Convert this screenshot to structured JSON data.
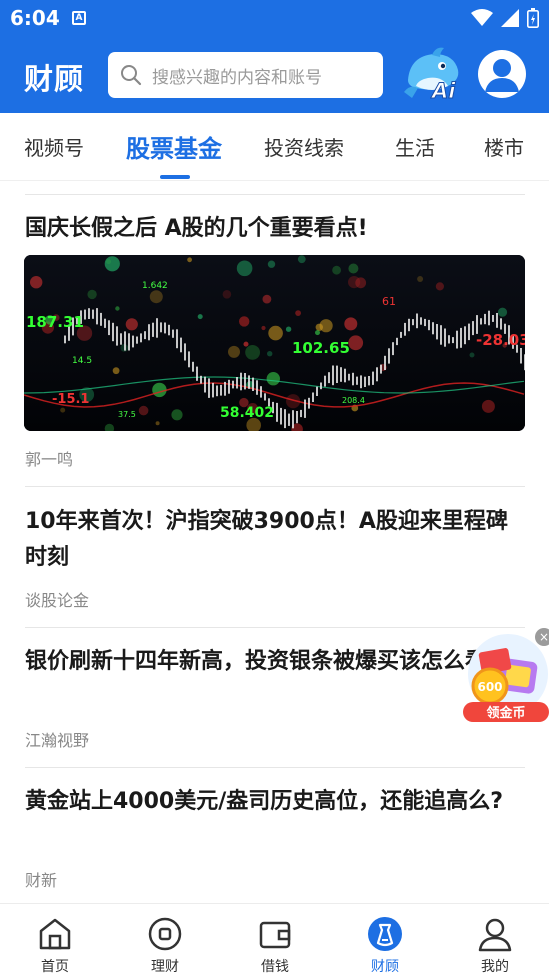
{
  "status_bar": {
    "time": "6:04"
  },
  "header": {
    "brand": "财顾",
    "search_placeholder": "搜感兴趣的内容和账号",
    "ai_badge": "Ai"
  },
  "tabs": [
    {
      "label": "视频号",
      "active": false
    },
    {
      "label": "股票基金",
      "active": true
    },
    {
      "label": "投资线索",
      "active": false
    },
    {
      "label": "生活",
      "active": false
    },
    {
      "label": "楼市",
      "active": false
    }
  ],
  "articles": [
    {
      "title": "国庆长假之后 A股的几个重要看点!",
      "source": "郭一鸣",
      "image_numbers": [
        "1.642",
        "187.31",
        "102.65",
        "-28.03",
        "58.402",
        "-15.1",
        "208.4",
        "37.5",
        "14.5",
        "61"
      ]
    },
    {
      "title": "10年来首次！沪指突破3900点！A股迎来里程碑时刻",
      "source": "谈股论金"
    },
    {
      "title": "银价刷新十四年新高，投资银条被爆买该怎么看?",
      "source": "江瀚视野"
    },
    {
      "title": "黄金站上4000美元/盎司历史高位，还能追高么?",
      "source": "财新"
    }
  ],
  "coin_widget": {
    "amount": "600",
    "label": "领金币",
    "close": "×"
  },
  "bottom_nav": [
    {
      "label": "首页",
      "icon": "home-icon",
      "active": false
    },
    {
      "label": "理财",
      "icon": "wealth-icon",
      "active": false
    },
    {
      "label": "借钱",
      "icon": "wallet-icon",
      "active": false
    },
    {
      "label": "财顾",
      "icon": "advisor-icon",
      "active": true
    },
    {
      "label": "我的",
      "icon": "profile-icon",
      "active": false
    }
  ],
  "colors": {
    "brand_blue": "#1d6fe3",
    "muted_text": "#888888",
    "coin_red": "#f0463c"
  }
}
